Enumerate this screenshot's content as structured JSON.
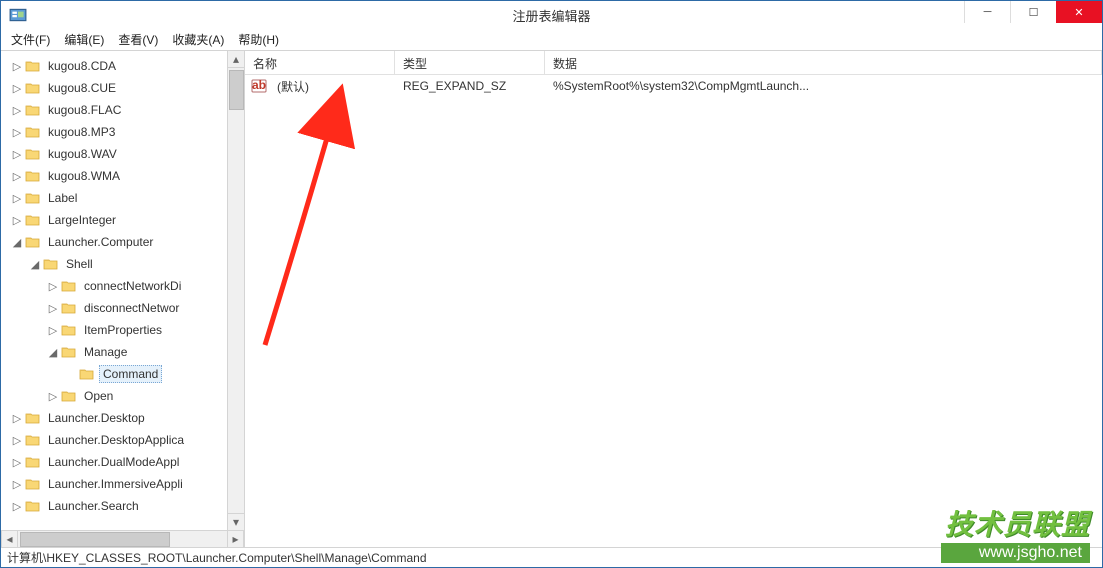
{
  "window": {
    "title": "注册表编辑器"
  },
  "menu": {
    "file": "文件(F)",
    "edit": "编辑(E)",
    "view": "查看(V)",
    "favorites": "收藏夹(A)",
    "help": "帮助(H)"
  },
  "tree": [
    {
      "label": "kugou8.CDA",
      "indent": 1,
      "exp": "closed"
    },
    {
      "label": "kugou8.CUE",
      "indent": 1,
      "exp": "closed"
    },
    {
      "label": "kugou8.FLAC",
      "indent": 1,
      "exp": "closed"
    },
    {
      "label": "kugou8.MP3",
      "indent": 1,
      "exp": "closed"
    },
    {
      "label": "kugou8.WAV",
      "indent": 1,
      "exp": "closed"
    },
    {
      "label": "kugou8.WMA",
      "indent": 1,
      "exp": "closed"
    },
    {
      "label": "Label",
      "indent": 1,
      "exp": "closed"
    },
    {
      "label": "LargeInteger",
      "indent": 1,
      "exp": "closed"
    },
    {
      "label": "Launcher.Computer",
      "indent": 1,
      "exp": "open"
    },
    {
      "label": "Shell",
      "indent": 2,
      "exp": "open"
    },
    {
      "label": "connectNetworkDi",
      "indent": 3,
      "exp": "closed"
    },
    {
      "label": "disconnectNetwor",
      "indent": 3,
      "exp": "closed"
    },
    {
      "label": "ItemProperties",
      "indent": 3,
      "exp": "closed"
    },
    {
      "label": "Manage",
      "indent": 3,
      "exp": "open"
    },
    {
      "label": "Command",
      "indent": 4,
      "exp": "none",
      "selected": true
    },
    {
      "label": "Open",
      "indent": 3,
      "exp": "closed"
    },
    {
      "label": "Launcher.Desktop",
      "indent": 1,
      "exp": "closed"
    },
    {
      "label": "Launcher.DesktopApplica",
      "indent": 1,
      "exp": "closed"
    },
    {
      "label": "Launcher.DualModeAppl",
      "indent": 1,
      "exp": "closed"
    },
    {
      "label": "Launcher.ImmersiveAppli",
      "indent": 1,
      "exp": "closed"
    },
    {
      "label": "Launcher.Search",
      "indent": 1,
      "exp": "closed"
    }
  ],
  "list": {
    "headers": {
      "name": "名称",
      "type": "类型",
      "data": "数据"
    },
    "rows": [
      {
        "name": "(默认)",
        "type": "REG_EXPAND_SZ",
        "data": "%SystemRoot%\\system32\\CompMgmtLaunch..."
      }
    ]
  },
  "status": "计算机\\HKEY_CLASSES_ROOT\\Launcher.Computer\\Shell\\Manage\\Command",
  "watermark": {
    "big": "技术员联盟",
    "url": "www.jsgho.net"
  }
}
